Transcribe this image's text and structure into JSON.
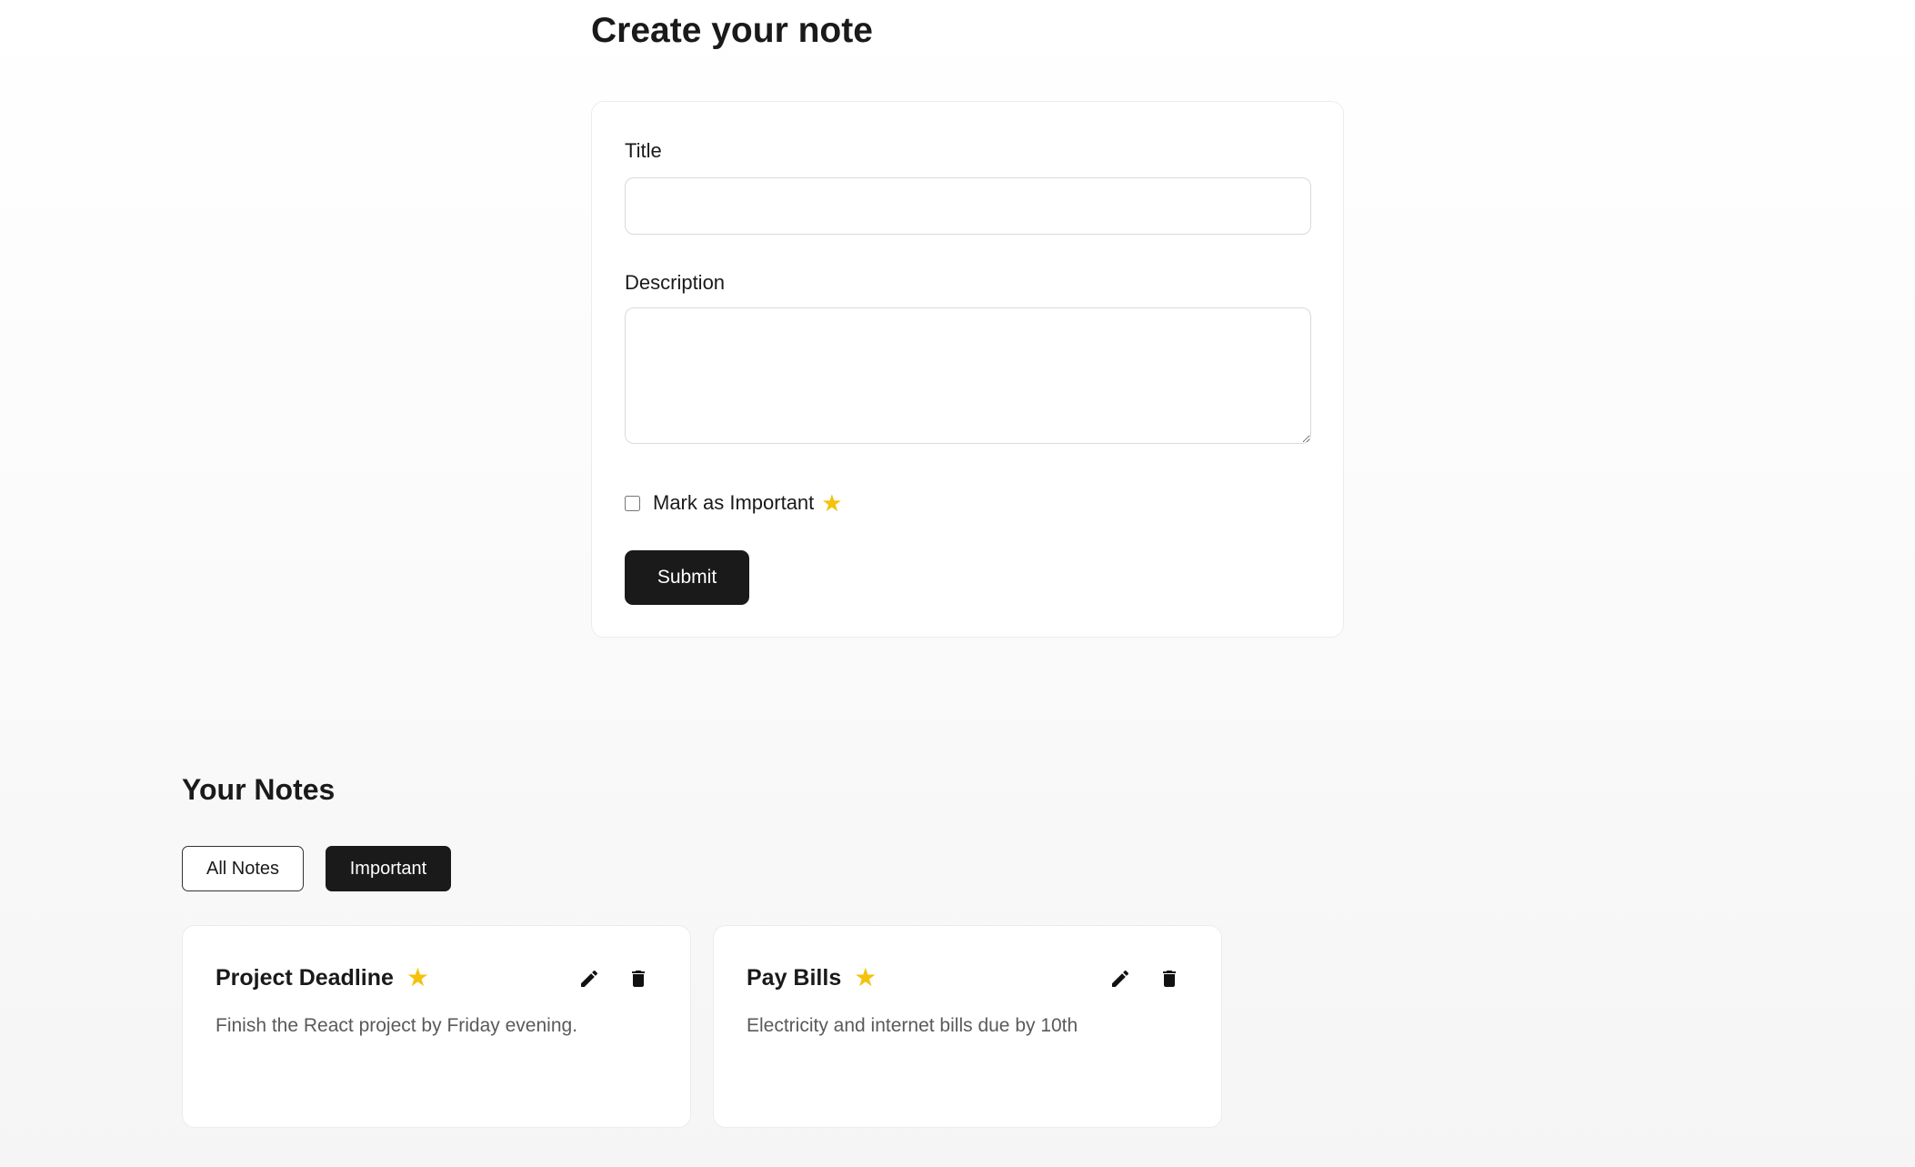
{
  "form": {
    "heading": "Create your note",
    "title_label": "Title",
    "title_value": "",
    "title_placeholder": "",
    "description_label": "Description",
    "description_value": "",
    "description_placeholder": "",
    "important_label": "Mark as Important",
    "important_checked": false,
    "important_icon": "star-icon",
    "submit_label": "Submit"
  },
  "notes_section": {
    "heading": "Your Notes",
    "filters": [
      {
        "label": "All Notes",
        "active": false
      },
      {
        "label": "Important",
        "active": true
      }
    ],
    "notes": [
      {
        "title": "Project Deadline",
        "description": "Finish the React project by Friday evening.",
        "important": true
      },
      {
        "title": "Pay Bills",
        "description": "Electricity and internet bills due by 10th",
        "important": true
      }
    ]
  },
  "icons": {
    "star": "star-icon",
    "edit": "pencil-icon",
    "delete": "trash-icon"
  },
  "colors": {
    "primary": "#1a1a1a",
    "star": "#f4c20d",
    "card_border": "#ececec",
    "input_border": "#dadada",
    "muted_text": "#5a5a5a",
    "background": "#fafafa"
  }
}
